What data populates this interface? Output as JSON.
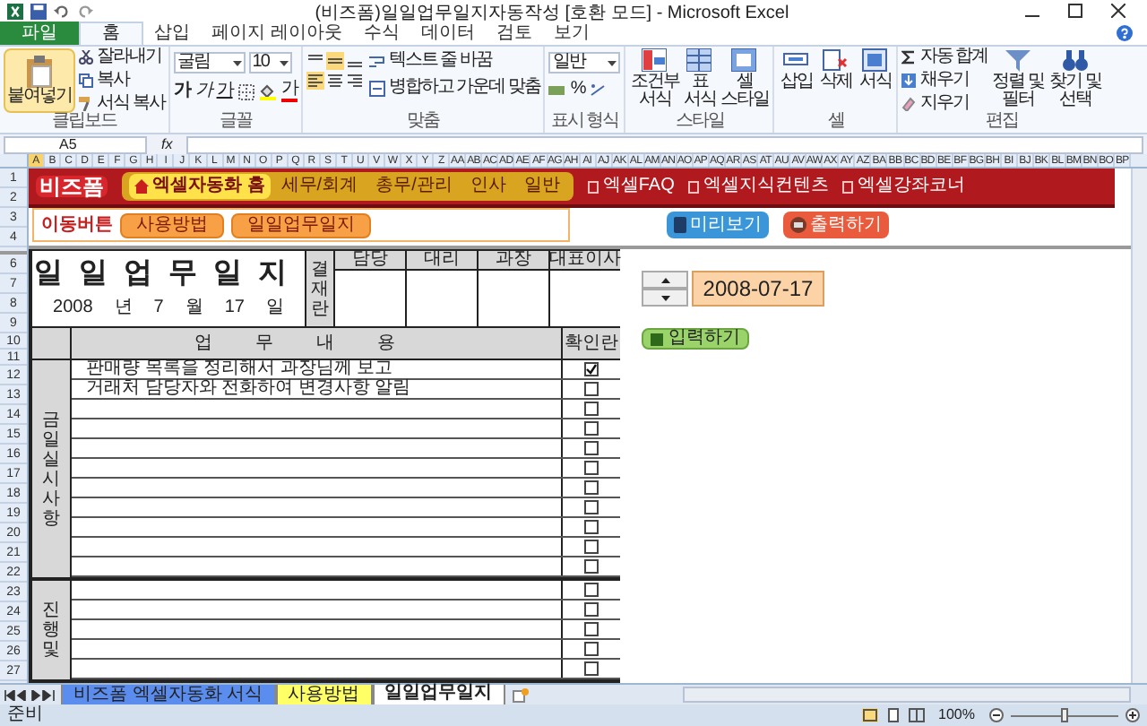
{
  "window": {
    "title": "(비즈폼)일일업무일지자동작성 [호환 모드] - Microsoft Excel"
  },
  "ribbon_tabs": [
    {
      "label": "파일",
      "kind": "file",
      "selected": false
    },
    {
      "label": "홈",
      "kind": "tab",
      "selected": true
    },
    {
      "label": "삽입",
      "kind": "tab",
      "selected": false
    },
    {
      "label": "페이지 레이아웃",
      "kind": "tab",
      "selected": false
    },
    {
      "label": "수식",
      "kind": "tab",
      "selected": false
    },
    {
      "label": "데이터",
      "kind": "tab",
      "selected": false
    },
    {
      "label": "검토",
      "kind": "tab",
      "selected": false
    },
    {
      "label": "보기",
      "kind": "tab",
      "selected": false
    }
  ],
  "clipboard": {
    "label": "클립보드",
    "paste": "붙여넣기",
    "cut": "잘라내기",
    "copy": "복사",
    "format_painter": "서식 복사"
  },
  "font": {
    "label": "글꼴",
    "face": "굴림",
    "size": "10",
    "bold": "가",
    "italic": "가",
    "underline": "가",
    "font_color": "가"
  },
  "alignment": {
    "label": "맞춤",
    "wrap": "텍스트 줄 바꿈",
    "merge": "병합하고 가운데 맞춤"
  },
  "number": {
    "label": "표시 형식",
    "format": "일반",
    "percent": "%"
  },
  "styles": {
    "label": "스타일",
    "conditional": "조건부 서식",
    "table": "표 서식",
    "cell": "셀 스타일"
  },
  "cells": {
    "label": "셀",
    "insert": "삽입",
    "delete": "삭제",
    "format": "서식"
  },
  "editing": {
    "label": "편집",
    "autosum": "자동 합계",
    "fill": "채우기",
    "clear": "지우기",
    "sort": "정렬 및 필터",
    "find": "찾기 및 선택"
  },
  "formula_bar": {
    "name_box": "A5",
    "fx": "fx"
  },
  "column_headers": [
    "A",
    "B",
    "C",
    "D",
    "E",
    "F",
    "G",
    "H",
    "I",
    "J",
    "K",
    "L",
    "M",
    "N",
    "O",
    "P",
    "Q",
    "R",
    "S",
    "T",
    "U",
    "V",
    "W",
    "X",
    "Y",
    "Z",
    "AA",
    "AB",
    "AC",
    "AD",
    "AE",
    "AF",
    "AG",
    "AH",
    "AI",
    "AJ",
    "AK",
    "AL",
    "AM",
    "AN",
    "AO",
    "AP",
    "AQ",
    "AR",
    "AS",
    "AT",
    "AU",
    "AV",
    "AW",
    "AX",
    "AY",
    "AZ",
    "BA",
    "BB",
    "BC",
    "BD",
    "BE",
    "BF",
    "BG",
    "BH",
    "BI",
    "BJ",
    "BK",
    "BL",
    "BM",
    "BN",
    "BO",
    "BP"
  ],
  "row_headers": [
    "1",
    "2",
    "3",
    "4",
    "6",
    "7",
    "8",
    "9",
    "10",
    "11",
    "12",
    "13",
    "14",
    "15",
    "16",
    "17",
    "18",
    "19",
    "20",
    "21",
    "22",
    "23",
    "24",
    "25",
    "26",
    "27"
  ],
  "banner": {
    "logo": "비즈폼",
    "nav": [
      {
        "label": "엑셀자동화 홈",
        "selected": true
      },
      {
        "label": "세무/회계",
        "selected": false
      },
      {
        "label": "총무/관리",
        "selected": false
      },
      {
        "label": "인사",
        "selected": false
      },
      {
        "label": "일반",
        "selected": false
      }
    ],
    "links": [
      "엑셀FAQ",
      "엑셀지식컨텐츠",
      "엑셀강좌코너"
    ]
  },
  "nav_bar": {
    "label": "이동버튼",
    "buttons": [
      "사용방법",
      "일일업무일지"
    ],
    "preview": "미리보기",
    "print": "출력하기"
  },
  "journal": {
    "title": "일일업무일지",
    "date": [
      "2008",
      "년",
      "7",
      "월",
      "17",
      "일"
    ],
    "approval": {
      "label": "결재란",
      "roles": [
        "담당",
        "대리",
        "과장",
        "대표이사"
      ]
    },
    "header": {
      "content": "업무내용",
      "check": "확인란"
    },
    "sections": [
      {
        "label": "금일실시사항",
        "rows": [
          {
            "text": "판매량 목록을 정리해서 과장님께 보고",
            "checked": true
          },
          {
            "text": "거래처 담당자와 전화하여 변경사항 알림",
            "checked": false
          },
          {
            "checked": false
          },
          {
            "checked": false
          },
          {
            "checked": false
          },
          {
            "checked": false
          },
          {
            "checked": false
          },
          {
            "checked": false
          },
          {
            "checked": false
          },
          {
            "checked": false
          },
          {
            "checked": false
          }
        ]
      },
      {
        "label": "진행및",
        "rows": [
          {
            "checked": false
          },
          {
            "checked": false
          },
          {
            "checked": false
          },
          {
            "checked": false
          },
          {
            "checked": false
          }
        ]
      }
    ]
  },
  "date_picker": {
    "value": "2008-07-17"
  },
  "input_button": "입력하기",
  "sheet_tabs": [
    {
      "label": "비즈폼 엑셀자동화 서식",
      "selected": false,
      "color": "#5b8def"
    },
    {
      "label": "사용방법",
      "selected": false,
      "color": "#ffff66"
    },
    {
      "label": "일일업무일지",
      "selected": true
    }
  ],
  "status_bar": {
    "text": "준비",
    "zoom": "100%",
    "zoom_slider": {
      "level": 0.5
    }
  }
}
